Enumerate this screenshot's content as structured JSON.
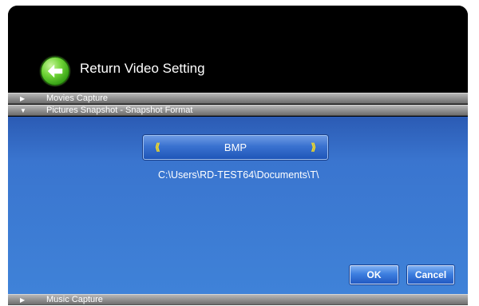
{
  "header": {
    "title": "Return Video Setting",
    "back_icon": "back-arrow-icon"
  },
  "sections": {
    "movies": {
      "label": "Movies Capture",
      "state": "collapsed"
    },
    "pictures": {
      "label": "Pictures Snapshot - Snapshot Format",
      "state": "expanded"
    },
    "music": {
      "label": "Music Capture",
      "state": "collapsed"
    }
  },
  "snapshot": {
    "format": "BMP",
    "path": "C:\\Users\\RD-TEST64\\Documents\\T\\"
  },
  "buttons": {
    "ok": "OK",
    "cancel": "Cancel"
  },
  "colors": {
    "background": "#000000",
    "panel": "#3a75cf",
    "section_bar": "#8e8e8e",
    "arrow_accent": "#ffe11a",
    "back_button": "#4cbf22"
  }
}
